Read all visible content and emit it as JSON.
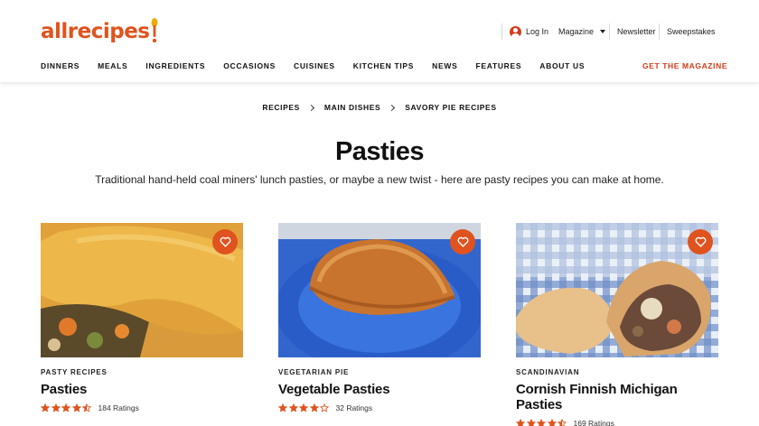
{
  "brand": {
    "logo_text": "allrecipes",
    "accent": "#e0531f",
    "accent_dark": "#d23c1a"
  },
  "utility": {
    "login_label": "Log In",
    "magazine_label": "Magazine",
    "newsletter_label": "Newsletter",
    "sweepstakes_label": "Sweepstakes"
  },
  "nav": {
    "items": [
      "DINNERS",
      "MEALS",
      "INGREDIENTS",
      "OCCASIONS",
      "CUISINES",
      "KITCHEN TIPS",
      "NEWS",
      "FEATURES",
      "ABOUT US"
    ],
    "cta": "GET THE MAGAZINE"
  },
  "breadcrumb": [
    "RECIPES",
    "MAIN DISHES",
    "SAVORY PIE RECIPES"
  ],
  "page": {
    "title": "Pasties",
    "description": "Traditional hand-held coal miners' lunch pasties, or maybe a new twist - here are pasty recipes you can make at home."
  },
  "cards": [
    {
      "tag": "PASTY RECIPES",
      "title": "Pasties",
      "rating": 4.5,
      "ratings_label": "184 Ratings",
      "icon": "heart-icon"
    },
    {
      "tag": "VEGETARIAN PIE",
      "title": "Vegetable Pasties",
      "rating": 4,
      "ratings_label": "32 Ratings",
      "icon": "heart-icon"
    },
    {
      "tag": "SCANDINAVIAN",
      "title": "Cornish Finnish Michigan Pasties",
      "rating": 4.5,
      "ratings_label": "169 Ratings",
      "icon": "heart-icon"
    }
  ]
}
